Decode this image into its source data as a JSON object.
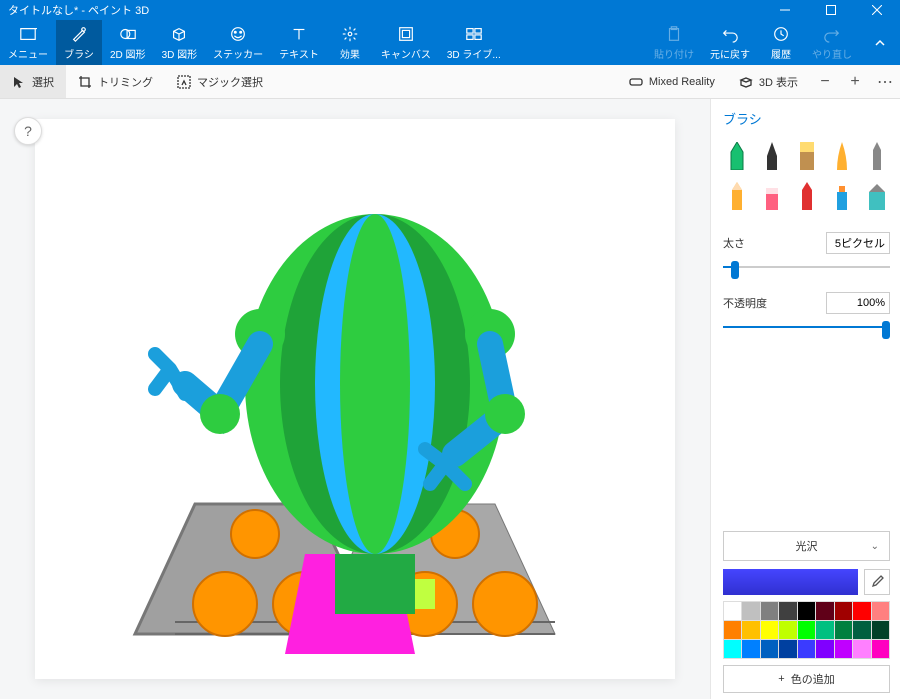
{
  "window": {
    "title": "タイトルなし* - ペイント 3D"
  },
  "ribbon": {
    "menu": "メニュー",
    "brush": "ブラシ",
    "shapes2d": "2D 図形",
    "shapes3d": "3D 図形",
    "sticker": "ステッカー",
    "text": "テキスト",
    "effects": "効果",
    "canvas": "キャンバス",
    "library3d": "3D ライブ...",
    "paste": "貼り付け",
    "undo": "元に戻す",
    "history": "履歴",
    "redo": "やり直し"
  },
  "subbar": {
    "select": "選択",
    "crop": "トリミング",
    "magic": "マジック選択",
    "mixed": "Mixed Reality",
    "view3d": "3D 表示",
    "minus": "−",
    "plus": "+",
    "more": "⋯"
  },
  "help": "?",
  "panel": {
    "title": "ブラシ",
    "thickness_label": "太さ",
    "thickness_value": "5ピクセル",
    "opacity_label": "不透明度",
    "opacity_value": "100%",
    "material": "光沢",
    "add_color": "色の追加",
    "plus": "+",
    "current_color": "#3b3bff",
    "palette": [
      "#ffffff",
      "#c0c0c0",
      "#808080",
      "#404040",
      "#000000",
      "#600018",
      "#a00000",
      "#ff0000",
      "#ff8080",
      "#ff8000",
      "#ffc000",
      "#ffff00",
      "#c0ff00",
      "#00ff00",
      "#00c080",
      "#008040",
      "#006040",
      "#004028",
      "#00ffff",
      "#0080ff",
      "#0060c0",
      "#0040a0",
      "#3b3bff",
      "#8000ff",
      "#c000ff",
      "#ff80ff",
      "#ff00c0"
    ]
  }
}
